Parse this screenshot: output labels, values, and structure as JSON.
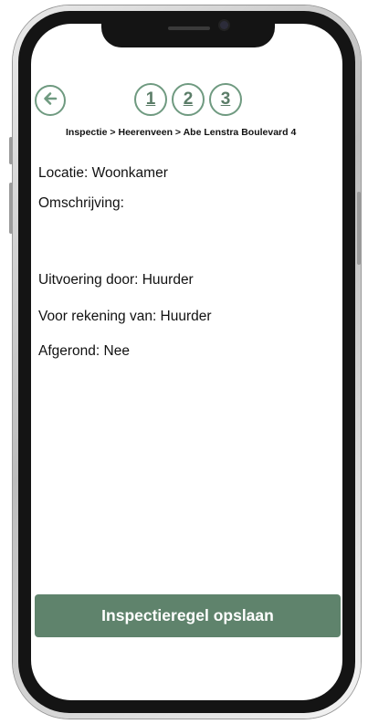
{
  "header": {
    "back_icon": "arrow-left-icon",
    "steps": [
      "1",
      "2",
      "3"
    ],
    "breadcrumb": "Inspectie > Heerenveen > Abe Lenstra Boulevard 4"
  },
  "details": {
    "locatie": "Locatie: Woonkamer",
    "omschrijving": "Omschrijving:",
    "uitvoering": "Uitvoering door: Huurder",
    "rekening": "Voor rekening van: Huurder",
    "afgerond": "Afgerond: Nee"
  },
  "footer": {
    "save_label": "Inspectieregel opslaan"
  },
  "colors": {
    "accent": "#6f9a80",
    "button_bg": "#5f836c"
  }
}
